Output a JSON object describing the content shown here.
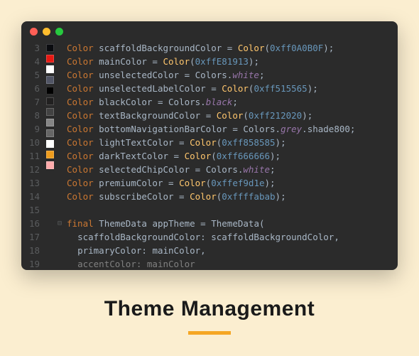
{
  "heading": "Theme Management",
  "traffic_lights": [
    "red",
    "yellow",
    "green"
  ],
  "line_numbers": [
    3,
    4,
    5,
    6,
    7,
    8,
    9,
    10,
    11,
    12,
    13,
    14,
    15,
    16,
    17,
    18,
    19
  ],
  "swatches": [
    "#0A0B0F",
    "#E81913",
    "#FFFFFF",
    "#515565",
    "#000000",
    "#212020",
    "#424242",
    "#858585",
    "#666666",
    "#FFFFFF",
    "#EF9D1E",
    "#FFABAB",
    "none",
    "none",
    "none",
    "none",
    "none"
  ],
  "fold_markers": [
    "",
    "",
    "",
    "",
    "",
    "",
    "",
    "",
    "",
    "",
    "",
    "",
    "",
    "⊟",
    "",
    "",
    ""
  ],
  "code_lines": [
    {
      "type": "decl",
      "name": "scaffoldBackgroundColor",
      "value_kind": "color_hex",
      "hex": "0xff0A0B0F"
    },
    {
      "type": "decl",
      "name": "mainColor",
      "value_kind": "color_hex",
      "hex": "0xffE81913"
    },
    {
      "type": "decl",
      "name": "unselectedColor",
      "value_kind": "colors_prop",
      "prop": "white"
    },
    {
      "type": "decl",
      "name": "unselectedLabelColor",
      "value_kind": "color_hex",
      "hex": "0xff515565"
    },
    {
      "type": "decl",
      "name": "blackColor",
      "value_kind": "colors_prop",
      "prop": "black"
    },
    {
      "type": "decl",
      "name": "textBackgroundColor",
      "value_kind": "color_hex",
      "hex": "0xff212020"
    },
    {
      "type": "decl",
      "name": "bottomNavigationBarColor",
      "value_kind": "colors_chain",
      "prop": "grey",
      "chain": "shade800"
    },
    {
      "type": "decl",
      "name": "lightTextColor",
      "value_kind": "color_hex",
      "hex": "0xff858585"
    },
    {
      "type": "decl",
      "name": "darkTextColor",
      "value_kind": "color_hex",
      "hex": "0xff666666"
    },
    {
      "type": "decl",
      "name": "selectedChipColor",
      "value_kind": "colors_prop",
      "prop": "white"
    },
    {
      "type": "decl",
      "name": "premiumColor",
      "value_kind": "color_hex",
      "hex": "0xffef9d1e"
    },
    {
      "type": "decl",
      "name": "subscribeColor",
      "value_kind": "color_hex",
      "hex": "0xffffabab"
    },
    {
      "type": "blank"
    },
    {
      "type": "final_line",
      "text_prefix": "final",
      "class_name": "ThemeData",
      "var_name": "appTheme",
      "ctor": "ThemeData"
    },
    {
      "type": "arg",
      "key": "scaffoldBackgroundColor",
      "ref": "scaffoldBackgroundColor",
      "comma": true
    },
    {
      "type": "arg",
      "key": "primaryColor",
      "ref": "mainColor",
      "comma": true
    },
    {
      "type": "arg_dim",
      "key": "accentColor",
      "ref": "mainColor",
      "comma": false
    }
  ],
  "tokens": {
    "color_type": "Color",
    "colors_class": "Colors",
    "final_kw": "final"
  }
}
